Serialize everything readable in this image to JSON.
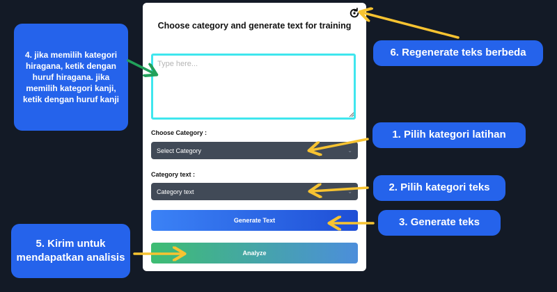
{
  "form": {
    "title": "Choose category and generate text for training",
    "textarea_placeholder": "Type here...",
    "choose_category_label": "Choose Category :",
    "choose_category_value": "Select Category",
    "category_text_label": "Category text :",
    "category_text_value": "Category text",
    "generate_button": "Generate Text",
    "analyze_button": "Analyze",
    "regenerate_icon": "refresh-icon"
  },
  "callouts": {
    "step1": "1. Pilih kategori latihan",
    "step2": "2. Pilih kategori teks",
    "step3": "3. Generate teks",
    "step4": "4. jika memilih kategori hiragana, ketik dengan huruf hiragana. jika memilih kategori kanji, ketik dengan huruf kanji",
    "step5": "5. Kirim untuk mendapatkan analisis",
    "step6": "6. Regenerate teks berbeda"
  },
  "colors": {
    "background": "#131a26",
    "callout": "#2563eb",
    "arrow_yellow": "#f7c331",
    "arrow_green": "#22a05a",
    "textarea_border": "#3fe6ee"
  }
}
